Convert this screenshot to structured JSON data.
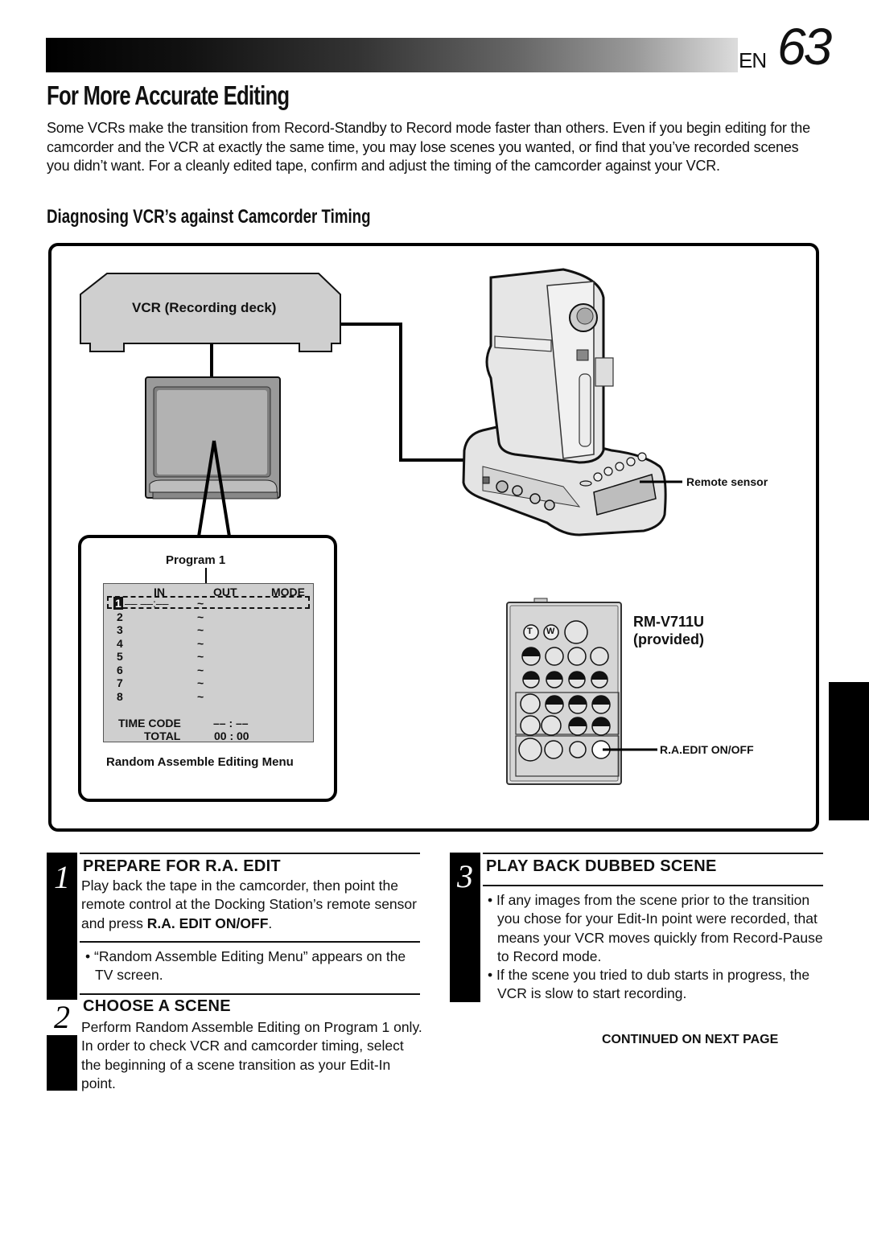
{
  "header": {
    "lang": "EN",
    "page_number": "63",
    "title": "For More Accurate Editing"
  },
  "intro": "Some VCRs make the transition from Record-Standby to Record mode faster than others. Even if you begin editing for the camcorder and the VCR at exactly the same time, you may lose scenes you wanted, or find that you’ve recorded scenes you didn’t want. For a cleanly edited tape, confirm and adjust the timing of the camcorder against your VCR.",
  "section_heading": "Diagnosing VCR’s against Camcorder Timing",
  "diagram": {
    "vcr_label": "VCR (Recording deck)",
    "remote_sensor_label": "Remote sensor",
    "remote_model": "RM-V711U",
    "remote_note": "(provided)",
    "ra_edit_label": "R.A.EDIT ON/OFF",
    "program_label": "Program 1",
    "menu_caption": "Random Assemble Editing Menu",
    "menu": {
      "col_in": "IN",
      "col_out": "OUT",
      "col_mode": "MODE",
      "row1_in": "–– ––:––",
      "rows": [
        "1",
        "2",
        "3",
        "4",
        "5",
        "6",
        "7",
        "8"
      ],
      "tilde": "~",
      "time_code_label": "TIME CODE",
      "time_code_value": "–– : ––",
      "total_label": "TOTAL",
      "total_value": "00 : 00"
    },
    "remote_buttons": {
      "t": "T",
      "w": "W"
    }
  },
  "steps": [
    {
      "number": "1",
      "title": "PREPARE FOR R.A. EDIT",
      "body_pre": "Play back the tape in the camcorder, then point the remote control at the Docking Station’s remote sensor and press ",
      "body_bold": "R.A. EDIT ON/OFF",
      "body_post": ".",
      "bullets": [
        "“Random Assemble Editing Menu” appears on the TV screen."
      ]
    },
    {
      "number": "2",
      "title": "CHOOSE A SCENE",
      "body": "Perform Random Assemble Editing on Program 1 only. In order to check VCR and camcorder timing, select the beginning of a scene transition as your Edit-In point."
    },
    {
      "number": "3",
      "title": "PLAY BACK DUBBED SCENE",
      "bullets": [
        "If any images from the scene prior to the transition you chose for your Edit-In point were recorded, that means your VCR moves quickly from Record-Pause to Record mode.",
        "If the scene you tried to dub starts in progress, the VCR is slow to start recording."
      ]
    }
  ],
  "continued": "CONTINUED ON NEXT PAGE"
}
